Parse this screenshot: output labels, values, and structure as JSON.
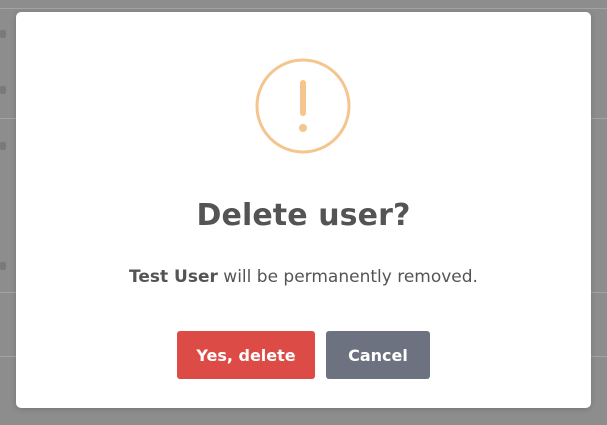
{
  "dialog": {
    "title": "Delete user?",
    "message_subject": "Test User",
    "message_rest": " will be permanently removed.",
    "confirm_label": "Yes, delete",
    "cancel_label": "Cancel",
    "icon": "warning-icon"
  },
  "colors": {
    "warning_ring": "#f4c58e",
    "confirm_button": "#dd4b46",
    "cancel_button": "#6d7281",
    "text": "#545454",
    "backdrop": "#8d8d8d"
  }
}
